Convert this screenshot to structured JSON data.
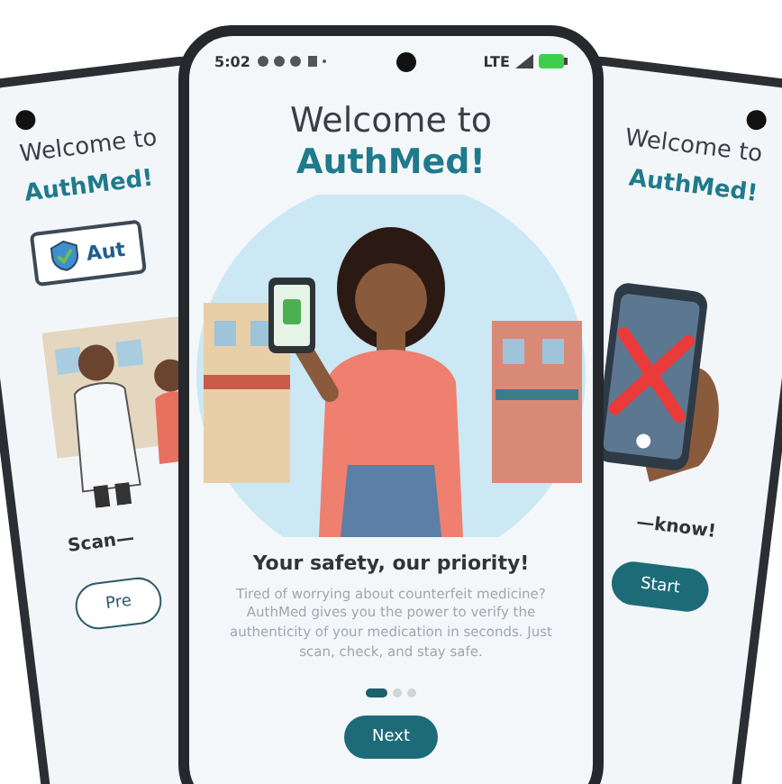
{
  "left_phone": {
    "title": "Welcome to",
    "brand": "AuthMed!",
    "sign": "Aut",
    "heading": "Scan—",
    "button": "Pre"
  },
  "center_phone": {
    "status_bar": {
      "time": "5:02",
      "network": "LTE"
    },
    "title": "Welcome to",
    "brand": "AuthMed!",
    "heading": "Your safety, our priority!",
    "body": "Tired of worrying about counterfeit medicine? AuthMed gives you the power to verify the authenticity of your medication in seconds. Just scan, check, and stay safe.",
    "pages": [
      {
        "selected": true
      },
      {
        "selected": false
      },
      {
        "selected": false
      }
    ],
    "button": "Next"
  },
  "right_phone": {
    "title": "Welcome to",
    "brand": "AuthMed!",
    "heading": "—know!",
    "button": "Start"
  }
}
